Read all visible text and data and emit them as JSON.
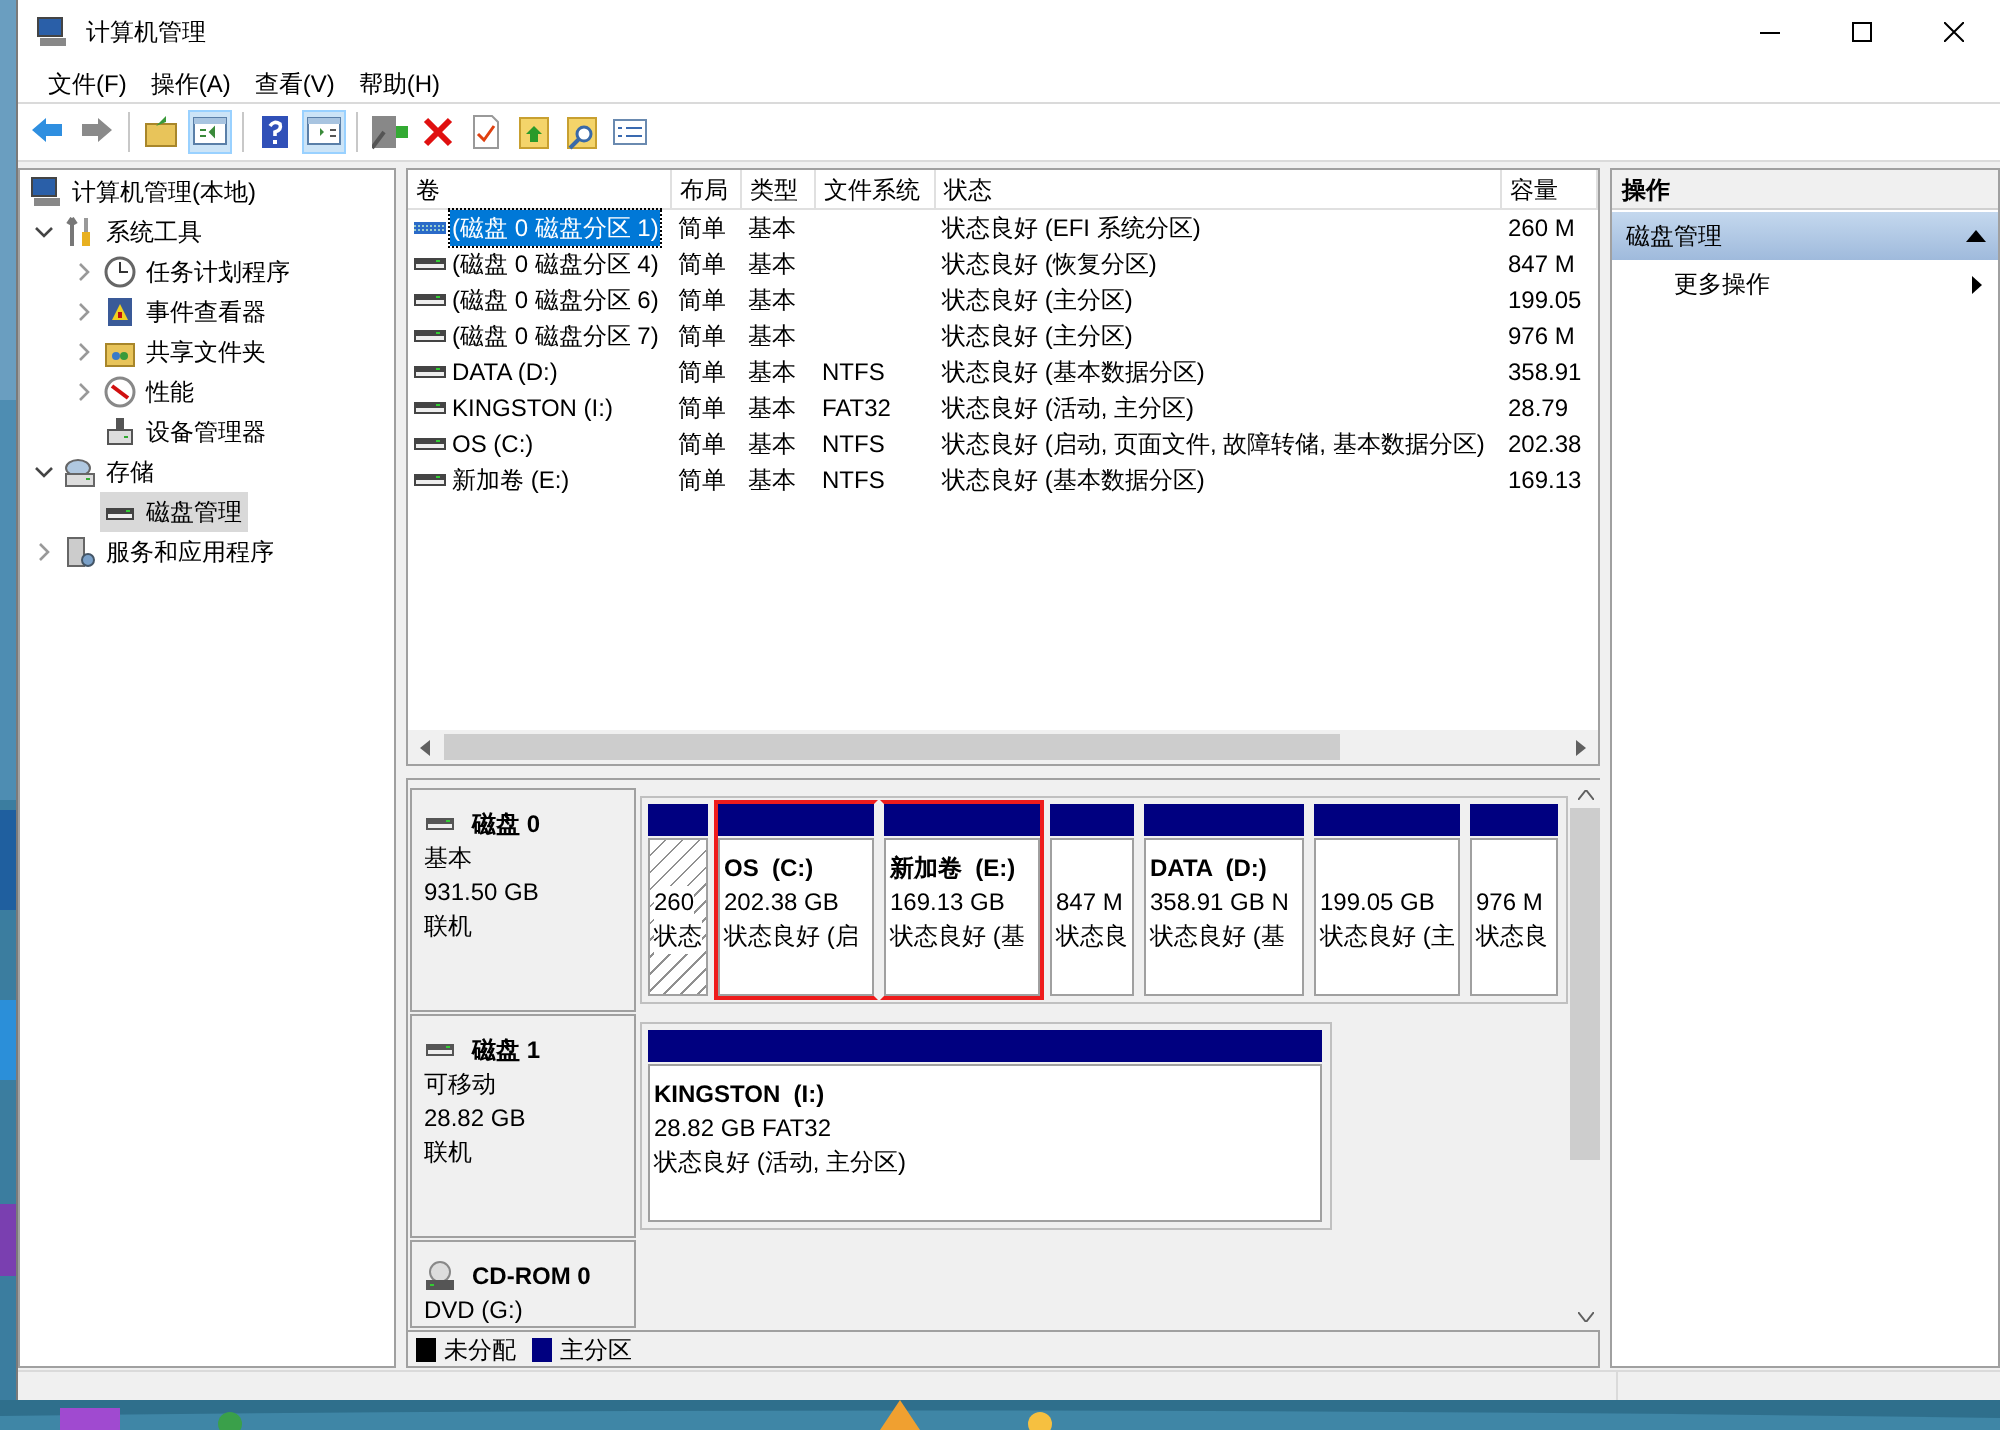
{
  "window": {
    "title": "计算机管理"
  },
  "menu": [
    "文件(F)",
    "操作(A)",
    "查看(V)",
    "帮助(H)"
  ],
  "toolbar": [
    {
      "kind": "back",
      "pressed": false
    },
    {
      "kind": "forward",
      "pressed": false
    },
    {
      "kind": "separator"
    },
    {
      "kind": "up",
      "pressed": false
    },
    {
      "kind": "tree",
      "pressed": true
    },
    {
      "kind": "separator"
    },
    {
      "kind": "help",
      "pressed": false
    },
    {
      "kind": "pane",
      "pressed": true
    },
    {
      "kind": "separator"
    },
    {
      "kind": "connect",
      "pressed": false
    },
    {
      "kind": "delete",
      "pressed": false
    },
    {
      "kind": "properties",
      "pressed": false
    },
    {
      "kind": "export",
      "pressed": false
    },
    {
      "kind": "find",
      "pressed": false
    },
    {
      "kind": "list",
      "pressed": false
    }
  ],
  "tree": [
    {
      "label": "计算机管理(本地)",
      "kind": "computer",
      "selected": false,
      "children": [
        {
          "label": "系统工具",
          "kind": "tools",
          "selected": false,
          "expanded": true,
          "children": [
            {
              "label": "任务计划程序",
              "kind": "clock",
              "selected": false,
              "expanded": false
            },
            {
              "label": "事件查看器",
              "kind": "event",
              "selected": false,
              "expanded": false
            },
            {
              "label": "共享文件夹",
              "kind": "share",
              "selected": false,
              "expanded": false
            },
            {
              "label": "性能",
              "kind": "perf",
              "selected": false,
              "expanded": false
            },
            {
              "label": "设备管理器",
              "kind": "device",
              "selected": false
            }
          ]
        },
        {
          "label": "存储",
          "kind": "storage",
          "selected": false,
          "expanded": true,
          "children": [
            {
              "label": "磁盘管理",
              "kind": "disk",
              "selected": true
            }
          ]
        },
        {
          "label": "服务和应用程序",
          "kind": "services",
          "selected": false,
          "expanded": false
        }
      ]
    }
  ],
  "table": {
    "columns": [
      "卷",
      "布局",
      "类型",
      "文件系统",
      "状态",
      "容量"
    ],
    "rows": [
      {
        "volume": "(磁盘 0 磁盘分区 1)",
        "layout": "简单",
        "type": "基本",
        "status": "状态良好 (EFI 系统分区)",
        "capacity": "260 M",
        "selected": true
      },
      {
        "volume": "(磁盘 0 磁盘分区 4)",
        "layout": "简单",
        "type": "基本",
        "status": "状态良好 (恢复分区)",
        "capacity": "847 M",
        "selected": false
      },
      {
        "volume": "(磁盘 0 磁盘分区 6)",
        "layout": "简单",
        "type": "基本",
        "status": "状态良好 (主分区)",
        "capacity": "199.05",
        "selected": false
      },
      {
        "volume": "(磁盘 0 磁盘分区 7)",
        "layout": "简单",
        "type": "基本",
        "status": "状态良好 (主分区)",
        "capacity": "976 M",
        "selected": false
      },
      {
        "volume": "DATA (D:)",
        "layout": "简单",
        "type": "基本",
        "filesystem": "NTFS",
        "status": "状态良好 (基本数据分区)",
        "capacity": "358.91",
        "selected": false
      },
      {
        "volume": "KINGSTON (I:)",
        "layout": "简单",
        "type": "基本",
        "filesystem": "FAT32",
        "status": "状态良好 (活动, 主分区)",
        "capacity": "28.79",
        "selected": false
      },
      {
        "volume": "OS (C:)",
        "layout": "简单",
        "type": "基本",
        "filesystem": "NTFS",
        "status": "状态良好 (启动, 页面文件, 故障转储, 基本数据分区)",
        "capacity": "202.38",
        "selected": false
      },
      {
        "volume": "新加卷 (E:)",
        "layout": "简单",
        "type": "基本",
        "filesystem": "NTFS",
        "status": "状态良好 (基本数据分区)",
        "capacity": "169.13",
        "selected": false
      }
    ]
  },
  "disks": [
    {
      "kind": "disk",
      "name": "磁盘 0",
      "type": "基本",
      "size": "931.50 GB",
      "state": "联机",
      "partitions": [
        {
          "size": "260",
          "status": "状态",
          "selected": true,
          "highlighted": false
        },
        {
          "title": "OS  (C:)",
          "size": "202.38 GB",
          "status": "状态良好 (启",
          "selected": false,
          "highlighted": true
        },
        {
          "title": "新加卷  (E:)",
          "size": "169.13 GB",
          "status": "状态良好 (基",
          "selected": false,
          "highlighted": true
        },
        {
          "size": "847 M",
          "status": "状态良",
          "selected": false,
          "highlighted": false
        },
        {
          "title": "DATA  (D:)",
          "size": "358.91 GB N",
          "status": "状态良好 (基",
          "selected": false,
          "highlighted": false
        },
        {
          "size": "199.05 GB",
          "status": "状态良好 (主",
          "selected": false,
          "highlighted": false
        },
        {
          "size": "976 M",
          "status": "状态良",
          "selected": false,
          "highlighted": false
        }
      ]
    },
    {
      "kind": "disk",
      "name": "磁盘 1",
      "type": "可移动",
      "size": "28.82 GB",
      "state": "联机",
      "partitions": [
        {
          "title": "KINGSTON  (I:)",
          "size": "28.82 GB FAT32",
          "status": "状态良好 (活动, 主分区)",
          "selected": false,
          "highlighted": false
        }
      ]
    },
    {
      "kind": "cdrom",
      "name": "CD-ROM 0",
      "type": "DVD (G:)"
    }
  ],
  "legend": [
    {
      "label": "未分配",
      "color": "#000000"
    },
    {
      "label": "主分区",
      "color": "#000080"
    }
  ],
  "actions": {
    "header": "操作",
    "section": "磁盘管理",
    "items": [
      "更多操作"
    ]
  }
}
